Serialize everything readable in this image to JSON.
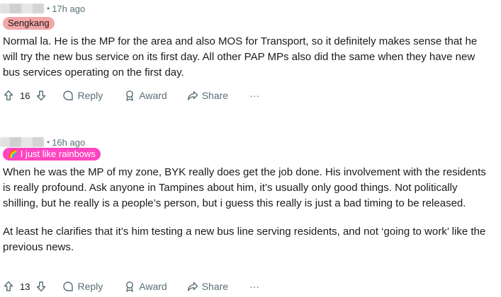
{
  "comments": [
    {
      "time": "17h ago",
      "flair": "Sengkang",
      "flair_emoji": "",
      "paragraphs": [
        "Normal la. He is the MP for the area and also MOS for Transport, so it definitely makes sense that he will try the new bus service on its first day. All other PAP MPs also did the same when they have new bus services operating on the first day."
      ],
      "votes": "16",
      "reply_label": "Reply",
      "award_label": "Award",
      "share_label": "Share",
      "more_label": "···"
    },
    {
      "time": "16h ago",
      "flair": "I just like rainbows",
      "flair_emoji": "🌈",
      "paragraphs": [
        "When he was the MP of my zone, BYK really does get the job done. His involvement with the residents is really profound. Ask anyone in Tampines about him, it’s usually only good things. Not politically shilling, but he really is a people’s person, but i guess this really is just a bad timing to be released.",
        "At least he clarifies that it’s him testing a new bus line serving residents, and not ‘going to work’ like the previous news."
      ],
      "votes": "13",
      "reply_label": "Reply",
      "award_label": "Award",
      "share_label": "Share",
      "more_label": "···"
    }
  ],
  "colors": {
    "sengkang_flair": "#f4a6a6",
    "rainbow_flair": "#ff45c1",
    "meta_text": "#576f76"
  },
  "icons": [
    "upvote-icon",
    "downvote-icon",
    "reply-icon",
    "award-icon",
    "share-icon",
    "more-icon"
  ]
}
